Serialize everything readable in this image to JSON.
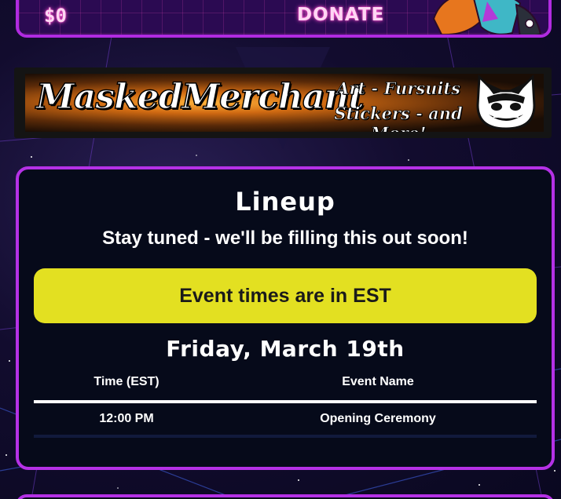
{
  "donation": {
    "amount": "$0",
    "button_label": "DONATE"
  },
  "banner": {
    "title": "MaskedMerchant",
    "tagline_line1": "Art - Fursuits",
    "tagline_line2": "Stickers - and More!"
  },
  "lineup": {
    "title": "Lineup",
    "subtitle": "Stay tuned - we'll be filling this out soon!",
    "timezone_notice": "Event times are in EST",
    "day_heading": "Friday, March 19th",
    "columns": [
      "Time (EST)",
      "Event Name"
    ],
    "rows": [
      {
        "time": "12:00 PM",
        "event": "Opening Ceremony"
      }
    ]
  },
  "colors": {
    "card_border": "#b531e6",
    "notice_bg": "#e3e021",
    "card_bg": "#060a1a"
  },
  "icons": [
    "mascot-illustration",
    "merchant-logo-face"
  ]
}
